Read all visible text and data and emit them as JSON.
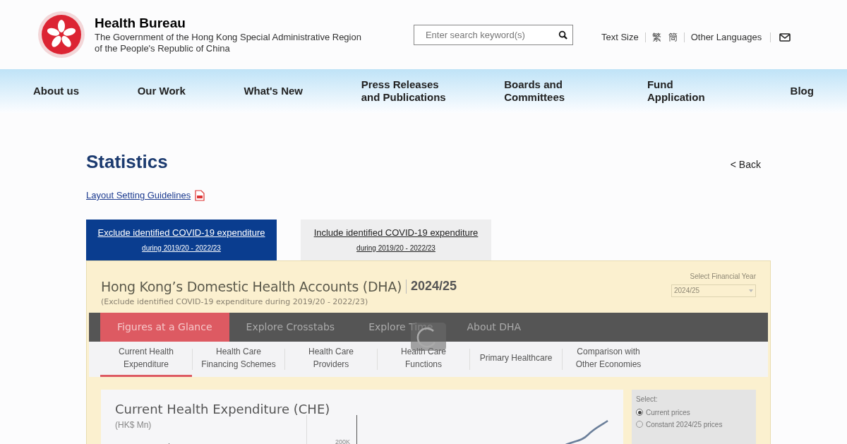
{
  "header": {
    "title": "Health Bureau",
    "subtitle_lines": [
      "The Government of the Hong Kong Special Administrative Region",
      "of the People's Republic of China"
    ],
    "search": {
      "placeholder": "Enter search keyword(s)"
    },
    "utilities": [
      "Text Size",
      "繁",
      "簡",
      "Other Languages"
    ]
  },
  "nav": [
    "About us",
    "Our Work",
    "What's New",
    "Press Releases and Publications",
    "Boards and Committees",
    "Fund Application",
    "Blog"
  ],
  "page_title": "Statistics",
  "back_link": "< Back",
  "guideline_link": "Layout Setting Guidelines",
  "covid_tabs": [
    {
      "label": "Exclude identified COVID-19 expenditure",
      "sublabel": "during 2019/20 - 2022/23",
      "selected": true
    },
    {
      "label": "Include identified COVID-19 expenditure",
      "sublabel": "during 2019/20 - 2022/23",
      "selected": false
    }
  ],
  "dashboard": {
    "title": "Hong Kong’s Domestic Health Accounts (DHA)",
    "year": "2024/25",
    "subtitle": "(Exclude identified COVID-19 expenditure during 2019/20 - 2022/23)",
    "year_select": {
      "label": "Select Financial Year",
      "value": "2024/25"
    },
    "main_tabs": [
      {
        "label": "Figures at a Glance",
        "selected": true
      },
      {
        "label": "Explore Crosstabs",
        "selected": false
      },
      {
        "label": "Explore Time",
        "selected": false
      },
      {
        "label": "About DHA",
        "selected": false
      }
    ],
    "sub_tabs": [
      {
        "label": "Current Health Expenditure",
        "selected": true
      },
      {
        "label": "Health Care Financing Schemes",
        "selected": false
      },
      {
        "label": "Health Care Providers",
        "selected": false
      },
      {
        "label": "Health Care Functions",
        "selected": false
      },
      {
        "label": "Primary Healthcare",
        "selected": false
      },
      {
        "label": "Comparison with Other Economies",
        "selected": false
      }
    ],
    "chart_card": {
      "title": "Current Health Expenditure (CHE)",
      "unit": "(HK$ Mn)",
      "tick": "200K"
    },
    "options": {
      "label": "Select:",
      "radios": [
        {
          "label": "Current prices",
          "selected": true
        },
        {
          "label": "Constant 2024/25 prices",
          "selected": false
        }
      ]
    }
  }
}
